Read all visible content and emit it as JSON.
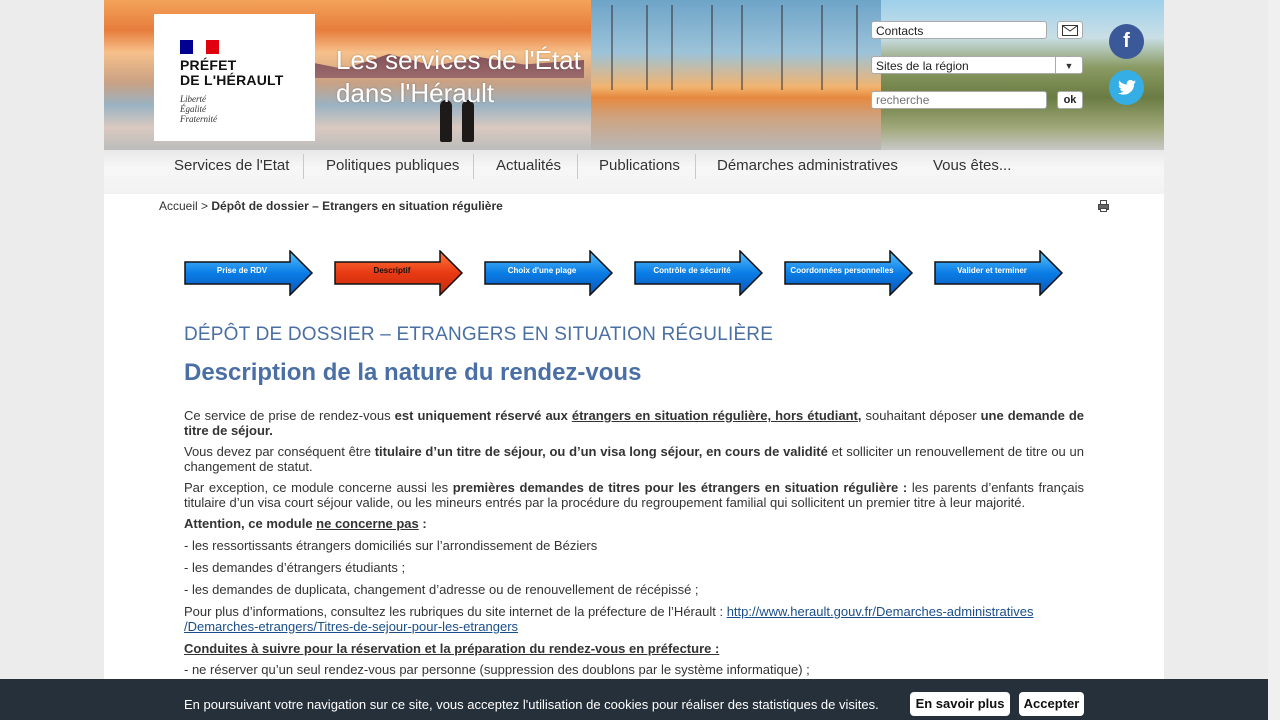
{
  "header": {
    "logo_lines": [
      "PRÉFET",
      "DE L'HÉRAULT"
    ],
    "motto": [
      "Liberté",
      "Égalité",
      "Fraternité"
    ],
    "site_title": [
      "Les services de l'État",
      "dans l'Hérault"
    ],
    "contacts_label": "Contacts",
    "sites_select_value": "Sites de la région",
    "search_placeholder": "recherche",
    "search_button": "ok",
    "facebook": "f",
    "twitter": "t",
    "flag_colors": [
      "#000091",
      "#ffffff",
      "#e1000f"
    ]
  },
  "nav": {
    "items": [
      "Services de l'Etat",
      "Politiques publiques",
      "Actualités",
      "Publications",
      "Démarches administratives",
      "Vous êtes..."
    ]
  },
  "breadcrumb": {
    "home": "Accueil",
    "separator": ">",
    "current": "Dépôt de dossier – Etrangers en situation régulière"
  },
  "steps": [
    {
      "label": "Prise de RDV",
      "state": "done"
    },
    {
      "label": "Descriptif",
      "state": "current"
    },
    {
      "label": "Choix d'une plage",
      "state": "todo"
    },
    {
      "label": "Contrôle de sécurité",
      "state": "todo"
    },
    {
      "label": "Coordonnées personnelles",
      "state": "todo"
    },
    {
      "label": "Valider et terminer",
      "state": "todo"
    }
  ],
  "content": {
    "page_title": "Dépôt de dossier – Etrangers en situation régulière",
    "subtitle": "Description de la nature du rendez-vous",
    "p1": {
      "a": "Ce service de prise de rendez-vous ",
      "b": "est uniquement réservé aux ",
      "c": "étrangers en situation régulière, hors étudiant",
      "d": ",",
      "e": " souhaitant déposer ",
      "f": "une demande de titre de séjour."
    },
    "p2": {
      "a": "Vous devez par conséquent être ",
      "b": "titulaire d’un titre de séjour, ou d’un visa long séjour, en cours de validité",
      "c": " et solliciter un renouvellement de titre ou un changement de statut."
    },
    "p3": {
      "a": "Par exception, ce module concerne aussi les ",
      "b": "premières demandes de titres pour les étrangers en situation régulière :",
      "c": " les parents d’enfants français titulaire d’un visa court séjour valide, ou les mineurs entrés par la procédure du regroupement familial qui sollicitent un premier titre à leur majorité."
    },
    "attention": {
      "a": "Attention, ce module ",
      "b": "ne concerne pas",
      "c": " :"
    },
    "list1": [
      "- les ressortissants étrangers domiciliés sur l’arrondissement de Béziers",
      "- les demandes d’étrangers étudiants ;",
      "- les demandes de duplicata, changement d’adresse ou de renouvellement de récépissé ;"
    ],
    "more_info": "Pour plus d’informations, consultez les rubriques du site internet de la préfecture de l’Hérault : ",
    "link_line1": "http://www.herault.gouv.fr/Demarches-administratives",
    "link_line2": "/Demarches-etrangers/Titres-de-sejour-pour-les-etrangers",
    "conduct_title": "Conduites à suivre pour la réservation et la préparation du rendez-vous en préfecture :",
    "conduct_item1": "- ne réserver qu’un seul rendez-vous par personne (suppression des doublons par le système informatique) ;"
  },
  "cookie": {
    "text": "En poursuivant votre navigation sur ce site, vous acceptez l'utilisation de cookies pour réaliser des statistiques de visites.",
    "more_button": "En savoir plus",
    "accept_button": "Accepter"
  }
}
